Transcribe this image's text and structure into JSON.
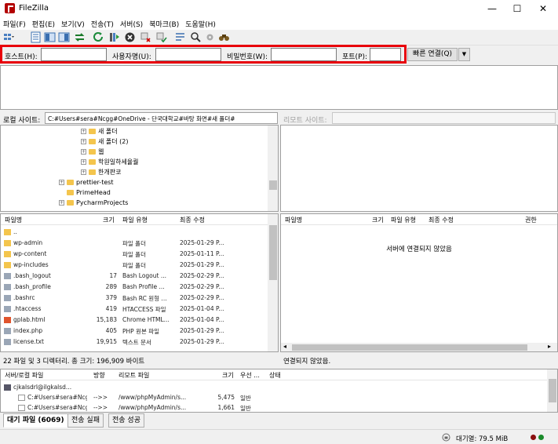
{
  "window": {
    "title": "FileZilla",
    "minimize": "—",
    "maximize": "☐",
    "close": "✕"
  },
  "menu": [
    "파일(F)",
    "편집(E)",
    "보기(V)",
    "전송(T)",
    "서버(S)",
    "북마크(B)",
    "도움말(H)"
  ],
  "quickconnect": {
    "host_label": "호스트(H):",
    "user_label": "사용자명(U):",
    "pass_label": "비밀번호(W):",
    "port_label": "포트(P):",
    "connect_button": "빠른 연결(Q)",
    "dropdown": "▼"
  },
  "local": {
    "site_label": "로컬 사이트:",
    "path": "C:#Users#sera#Ncgg#OneDrive - 단국대학교#바탕 화면#새 폴더#",
    "tree": [
      {
        "label": "새 폴더",
        "expand": "+"
      },
      {
        "label": "새 폴더 (2)",
        "expand": "+"
      },
      {
        "label": "웹",
        "expand": "+"
      },
      {
        "label": "학원일하세율퀄",
        "expand": "+"
      },
      {
        "label": "한개판코",
        "expand": "+"
      },
      {
        "label": "prettier-test",
        "expand": "+"
      },
      {
        "label": "PrimeHead",
        "expand": ""
      },
      {
        "label": "PycharmProjects",
        "expand": "+"
      }
    ],
    "columns": {
      "name": "파일명",
      "size": "크기",
      "type": "파일 유형",
      "modified": "최종 수정"
    },
    "files": [
      {
        "name": "..",
        "size": "",
        "type": "",
        "modified": ""
      },
      {
        "name": "wp-admin",
        "size": "",
        "type": "파일 폴더",
        "modified": "2025-01-29 P..."
      },
      {
        "name": "wp-content",
        "size": "",
        "type": "파일 폴더",
        "modified": "2025-01-11 P..."
      },
      {
        "name": "wp-includes",
        "size": "",
        "type": "파일 폴더",
        "modified": "2025-01-29 P..."
      },
      {
        "name": ".bash_logout",
        "size": "17",
        "type": "Bash Logout ...",
        "modified": "2025-02-29 P..."
      },
      {
        "name": ".bash_profile",
        "size": "289",
        "type": "Bash Profile ...",
        "modified": "2025-02-29 P..."
      },
      {
        "name": ".bashrc",
        "size": "379",
        "type": "Bash RC 원형 ...",
        "modified": "2025-02-29 P..."
      },
      {
        "name": ".htaccess",
        "size": "419",
        "type": "HTACCESS 파일",
        "modified": "2025-01-04 P..."
      },
      {
        "name": "gplab.html",
        "size": "15,183",
        "type": "Chrome HTML...",
        "modified": "2025-01-04 P..."
      },
      {
        "name": "index.php",
        "size": "405",
        "type": "PHP 원본 파일",
        "modified": "2025-01-29 P..."
      },
      {
        "name": "license.txt",
        "size": "19,915",
        "type": "텍스트 문서",
        "modified": "2025-01-29 P..."
      }
    ],
    "status": "22 파일 및 3 디렉터리. 총 크기: 196,909 바이트"
  },
  "remote": {
    "site_label": "리모트 사이트:",
    "columns": {
      "name": "파일명",
      "size": "크기",
      "type": "파일 유형",
      "modified": "최종 수정",
      "perm": "권한"
    },
    "empty_message": "서버에 연결되지 않았음",
    "status": "연결되지 않았음."
  },
  "queue": {
    "columns": {
      "local": "서버/로컬 파일",
      "direction": "방향",
      "remote": "리모트 파일",
      "size": "크기",
      "priority": "우선 ...",
      "status": "상태"
    },
    "rows": [
      {
        "local": "cjkalsdrl@ilgkalsd...",
        "direction": "",
        "remote": "",
        "size": "",
        "priority": "",
        "status": ""
      },
      {
        "local": "C:#Users#sera#Ncgg#O...",
        "direction": "-->>",
        "remote": "/www/phpMyAdmin/s...",
        "size": "5,475",
        "priority": "일반",
        "status": ""
      },
      {
        "local": "C:#Users#sera#Ncgg#O...",
        "direction": "-->>",
        "remote": "/www/phpMyAdmin/s...",
        "size": "1,661",
        "priority": "일반",
        "status": ""
      }
    ],
    "tabs": [
      "대기 파일 (6069)",
      "전송 실패",
      "전송 성공"
    ]
  },
  "statusbar": {
    "queue_label": "대기열: 79.5 MiB"
  }
}
